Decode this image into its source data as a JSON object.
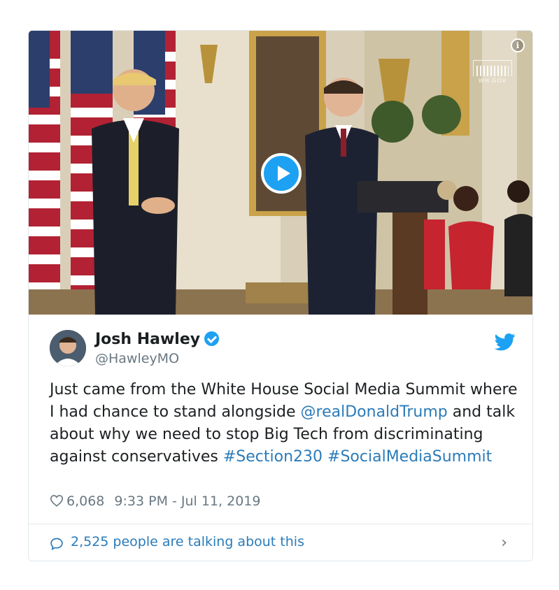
{
  "media": {
    "play_icon": "play-icon",
    "info_icon_glyph": "i",
    "watermark_text": "WH.GOV"
  },
  "author": {
    "name": "Josh Hawley",
    "handle": "@HawleyMO",
    "verified_icon": "verified-badge-icon"
  },
  "brand": {
    "icon": "twitter-bird-icon",
    "color": "#1da1f2"
  },
  "tweet": {
    "text_1": "Just came from the White House Social Media Summit where I had chance to stand alongside ",
    "mention": "@realDonaldTrump",
    "text_2": " and talk about why we need to stop Big Tech from discriminating against conservatives ",
    "hashtag_1": "#Section230",
    "hashtag_2": "#SocialMediaSummit"
  },
  "meta": {
    "likes": "6,068",
    "timestamp": "9:33 PM - Jul 11, 2019"
  },
  "footer": {
    "talking": "2,525 people are talking about this",
    "chevron": "›"
  },
  "colors": {
    "link": "#2b7bb9",
    "text": "#1c2022",
    "muted": "#697882",
    "border": "#e1e8ed"
  }
}
